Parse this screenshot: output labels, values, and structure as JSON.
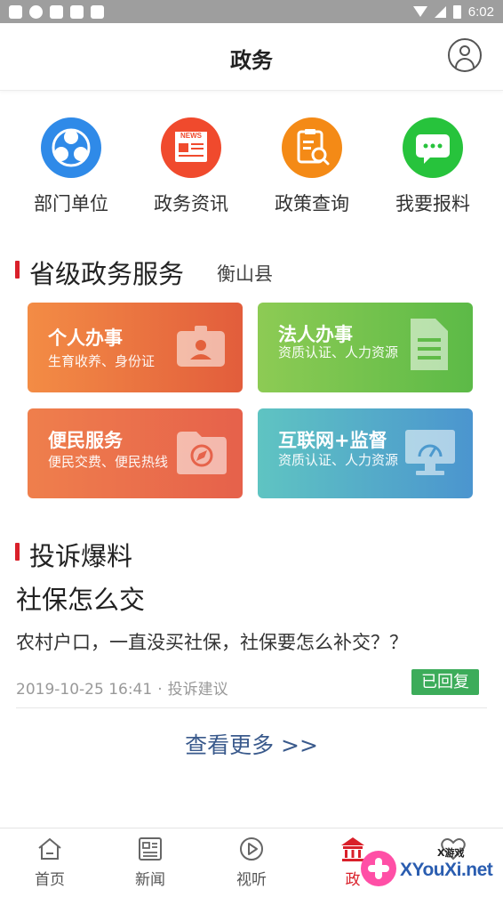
{
  "status_bar": {
    "time": "6:02"
  },
  "header": {
    "title": "政务"
  },
  "quick_links": [
    {
      "label": "部门单位",
      "icon": "department-icon",
      "color": "#2f8ae8"
    },
    {
      "label": "政务资讯",
      "icon": "news-icon",
      "color": "#f04a2d"
    },
    {
      "label": "政策查询",
      "icon": "policy-search-icon",
      "color": "#f48a16"
    },
    {
      "label": "我要报料",
      "icon": "report-chat-icon",
      "color": "#27c33c"
    }
  ],
  "services": {
    "title": "省级政务服务",
    "region": "衡山县",
    "cards": [
      {
        "title": "个人办事",
        "desc": "生育收养、身份证",
        "icon": "id-card-icon"
      },
      {
        "title": "法人办事",
        "desc": "资质认证、人力资源",
        "icon": "document-icon"
      },
      {
        "title": "便民服务",
        "desc": "便民交费、便民热线",
        "icon": "folder-compass-icon"
      },
      {
        "title": "互联网+监督",
        "desc": "资质认证、人力资源",
        "icon": "monitor-icon"
      }
    ]
  },
  "complaints": {
    "title": "投诉爆料",
    "item": {
      "title": "社保怎么交",
      "body": "农村户口，一直没买社保，社保要怎么补交？？",
      "datetime": "2019-10-25 16:41",
      "category": "投诉建议",
      "status": "已回复"
    },
    "more": "查看更多 >>"
  },
  "tabbar": [
    {
      "label": "首页",
      "icon": "home-icon",
      "active": false
    },
    {
      "label": "新闻",
      "icon": "news-tab-icon",
      "active": false
    },
    {
      "label": "视听",
      "icon": "play-icon",
      "active": false
    },
    {
      "label": "政",
      "icon": "government-icon",
      "active": true
    },
    {
      "label": "",
      "icon": "heart-icon",
      "active": false
    }
  ],
  "watermark": {
    "text": "XYouXi.net",
    "small": "X游戏"
  },
  "colors": {
    "accent": "#d9202a",
    "link": "#3a5a8c",
    "badge": "#3cac5a"
  }
}
